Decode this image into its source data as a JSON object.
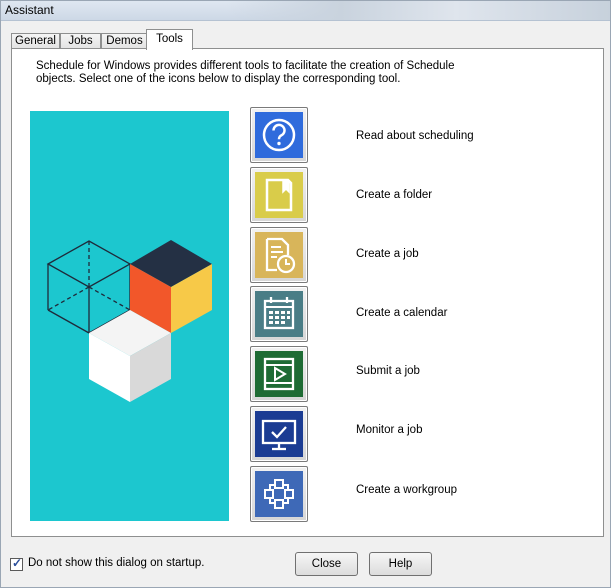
{
  "window": {
    "title": "Assistant"
  },
  "tabs": [
    {
      "label": "General"
    },
    {
      "label": "Jobs"
    },
    {
      "label": "Demos"
    },
    {
      "label": "Tools",
      "active": true
    }
  ],
  "intro": {
    "line1": "Schedule for Windows provides different tools to facilitate the creation of Schedule",
    "line2": "objects. Select one of the icons below to display the corresponding tool."
  },
  "illustration": {
    "background": "#1cc7cf"
  },
  "tools": [
    {
      "label": "Read about scheduling",
      "icon": "help-icon",
      "color": "#2f6bdc"
    },
    {
      "label": "Create a folder",
      "icon": "folder-icon",
      "color": "#d9cc4a"
    },
    {
      "label": "Create a job",
      "icon": "job-icon",
      "color": "#d8b55a"
    },
    {
      "label": "Create a calendar",
      "icon": "calendar-icon",
      "color": "#4a7d86"
    },
    {
      "label": "Submit a job",
      "icon": "play-icon",
      "color": "#1e6b34"
    },
    {
      "label": "Monitor a job",
      "icon": "monitor-icon",
      "color": "#1b3c93"
    },
    {
      "label": "Create a workgroup",
      "icon": "workgroup-icon",
      "color": "#3e69b7"
    }
  ],
  "footer": {
    "startup_checkbox_label": "Do not show this dialog on startup.",
    "startup_checked": true,
    "close_label": "Close",
    "help_label": "Help"
  }
}
